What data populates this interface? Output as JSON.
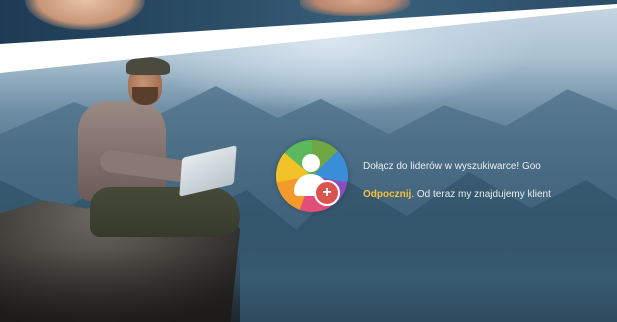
{
  "hero": {
    "line1": "Dołącz do liderów w wyszukiwarce! Goo",
    "line2_accent": "Odpocznij",
    "line2_rest": ". Od teraz my znajdujemy klient",
    "accent_color": "#f4c13a"
  },
  "logo": {
    "icon": "add-user-icon",
    "plus_symbol": "+"
  }
}
